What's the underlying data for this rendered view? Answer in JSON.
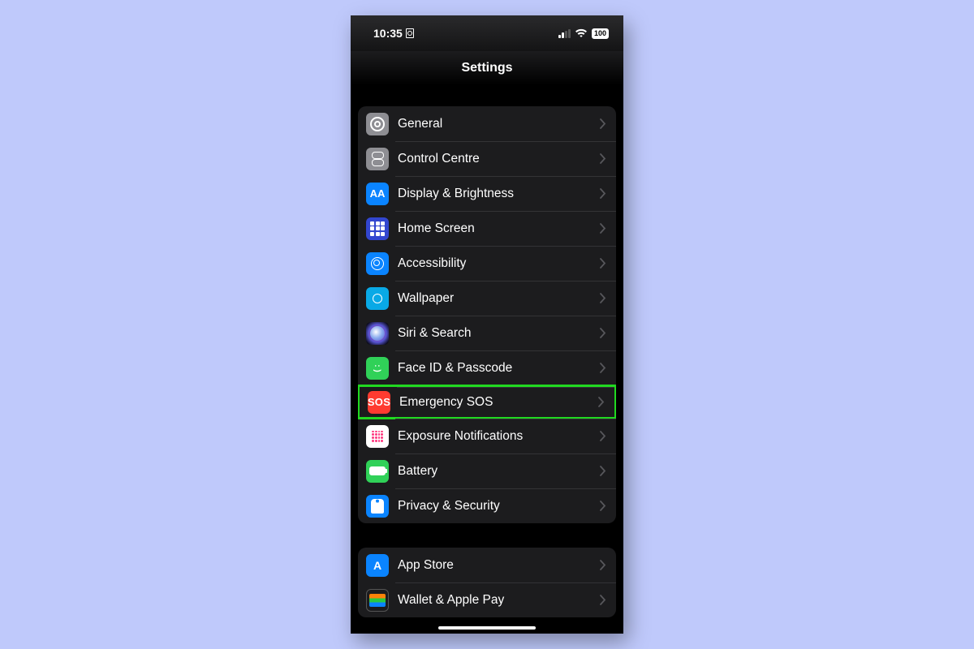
{
  "status": {
    "time": "10:35",
    "battery": "100"
  },
  "navbar": {
    "title": "Settings"
  },
  "groups": [
    {
      "rows": [
        {
          "id": "general",
          "label": "General",
          "icon": "gear-icon"
        },
        {
          "id": "control-centre",
          "label": "Control Centre",
          "icon": "switches-icon"
        },
        {
          "id": "display-brightness",
          "label": "Display & Brightness",
          "icon": "text-size-icon"
        },
        {
          "id": "home-screen",
          "label": "Home Screen",
          "icon": "grid-icon"
        },
        {
          "id": "accessibility",
          "label": "Accessibility",
          "icon": "accessibility-icon"
        },
        {
          "id": "wallpaper",
          "label": "Wallpaper",
          "icon": "flower-icon"
        },
        {
          "id": "siri-search",
          "label": "Siri & Search",
          "icon": "siri-icon"
        },
        {
          "id": "face-id-passcode",
          "label": "Face ID & Passcode",
          "icon": "faceid-icon"
        },
        {
          "id": "emergency-sos",
          "label": "Emergency SOS",
          "icon": "sos-icon",
          "highlighted": true
        },
        {
          "id": "exposure-notifications",
          "label": "Exposure Notifications",
          "icon": "exposure-icon"
        },
        {
          "id": "battery",
          "label": "Battery",
          "icon": "battery-icon"
        },
        {
          "id": "privacy-security",
          "label": "Privacy & Security",
          "icon": "hand-icon"
        }
      ]
    },
    {
      "rows": [
        {
          "id": "app-store",
          "label": "App Store",
          "icon": "appstore-icon"
        },
        {
          "id": "wallet-apple-pay",
          "label": "Wallet & Apple Pay",
          "icon": "wallet-icon"
        }
      ]
    }
  ],
  "iconText": {
    "display-brightness": "AA",
    "emergency-sos": "SOS"
  }
}
